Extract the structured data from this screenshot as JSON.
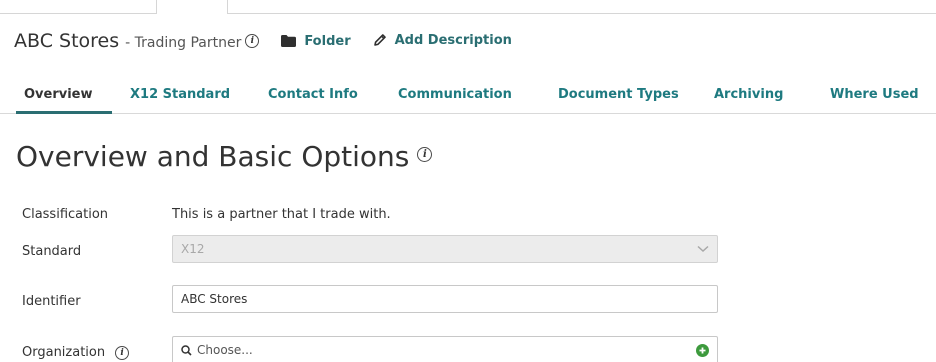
{
  "header": {
    "title": "ABC Stores",
    "subtitle": "- Trading Partner",
    "folder_label": "Folder",
    "add_description_label": "Add Description"
  },
  "tabs": [
    {
      "label": "Overview",
      "active": true
    },
    {
      "label": "X12 Standard",
      "active": false
    },
    {
      "label": "Contact Info",
      "active": false
    },
    {
      "label": "Communication",
      "active": false
    },
    {
      "label": "Document Types",
      "active": false
    },
    {
      "label": "Archiving",
      "active": false
    },
    {
      "label": "Where Used",
      "active": false
    }
  ],
  "section": {
    "title": "Overview and Basic Options"
  },
  "form": {
    "classification": {
      "label": "Classification",
      "value": "This is a partner that I trade with."
    },
    "standard": {
      "label": "Standard",
      "value": "X12"
    },
    "identifier": {
      "label": "Identifier",
      "value": "ABC Stores"
    },
    "organization": {
      "label": "Organization",
      "placeholder": "Choose..."
    }
  },
  "colors": {
    "accent": "#1e7a80",
    "text": "#333333",
    "add_button": "#3d9a3d",
    "disabled_field": "#ececec"
  },
  "icons": {
    "info": "info-icon",
    "folder": "folder-icon",
    "edit": "pencil-icon",
    "search": "search-icon",
    "chevron": "chevron-down-icon",
    "add": "plus-circle-icon"
  }
}
